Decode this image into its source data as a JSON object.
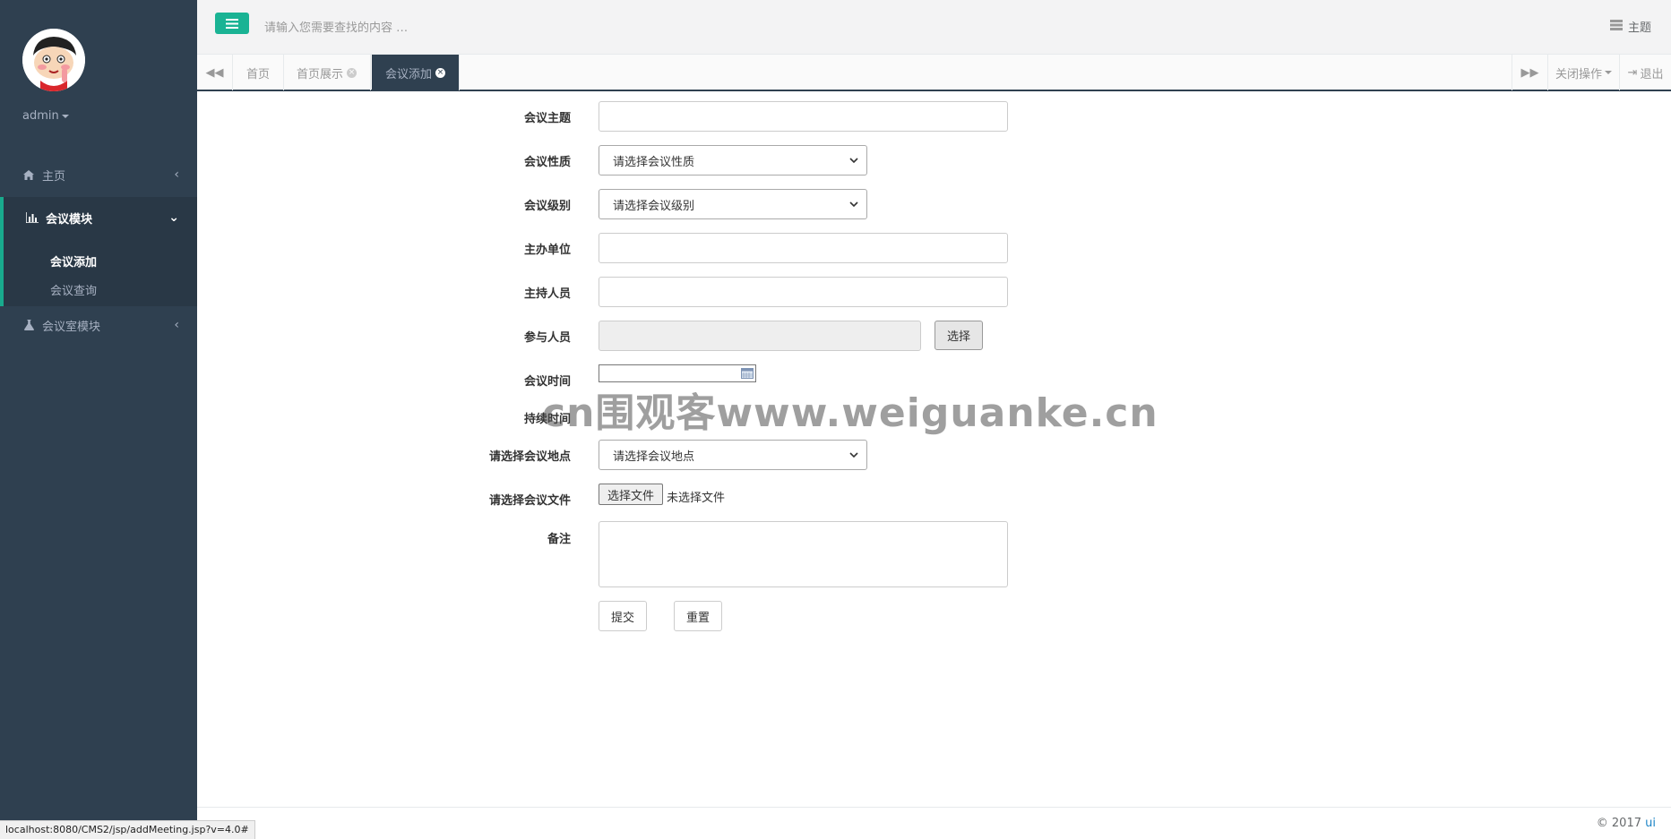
{
  "sidebar": {
    "user": "admin",
    "menu": {
      "home": "主页",
      "meeting_module": "会议模块",
      "meeting_add": "会议添加",
      "meeting_query": "会议查询",
      "room_module": "会议室模块"
    }
  },
  "topbar": {
    "search_placeholder": "请输入您需要查找的内容 …",
    "theme": "主题"
  },
  "tabs": {
    "items": [
      {
        "label": "首页"
      },
      {
        "label": "首页展示"
      },
      {
        "label": "会议添加"
      }
    ],
    "close_ops": "关闭操作",
    "logout": "退出"
  },
  "form": {
    "subject_label": "会议主题",
    "nature_label": "会议性质",
    "nature_value": "请选择会议性质",
    "level_label": "会议级别",
    "level_value": "请选择会议级别",
    "organizer_label": "主办单位",
    "host_label": "主持人员",
    "participants_label": "参与人员",
    "choose_button": "选择",
    "time_label": "会议时间",
    "duration_label": "持续时间",
    "location_label": "请选择会议地点",
    "location_value": "请选择会议地点",
    "file_label": "请选择会议文件",
    "file_button": "选择文件",
    "file_status": "未选择文件",
    "remark_label": "备注",
    "submit": "提交",
    "reset": "重置"
  },
  "watermark": "cn围观客www.weiguanke.cn",
  "footer": {
    "copyright": "© 2017 ",
    "ui_link": "ui"
  },
  "statusbar_url": "localhost:8080/CMS2/jsp/addMeeting.jsp?v=4.0#",
  "colors": {
    "sidebar_bg": "#2f4050",
    "accent": "#1ab394",
    "active_tab_bg": "#2f4050"
  }
}
